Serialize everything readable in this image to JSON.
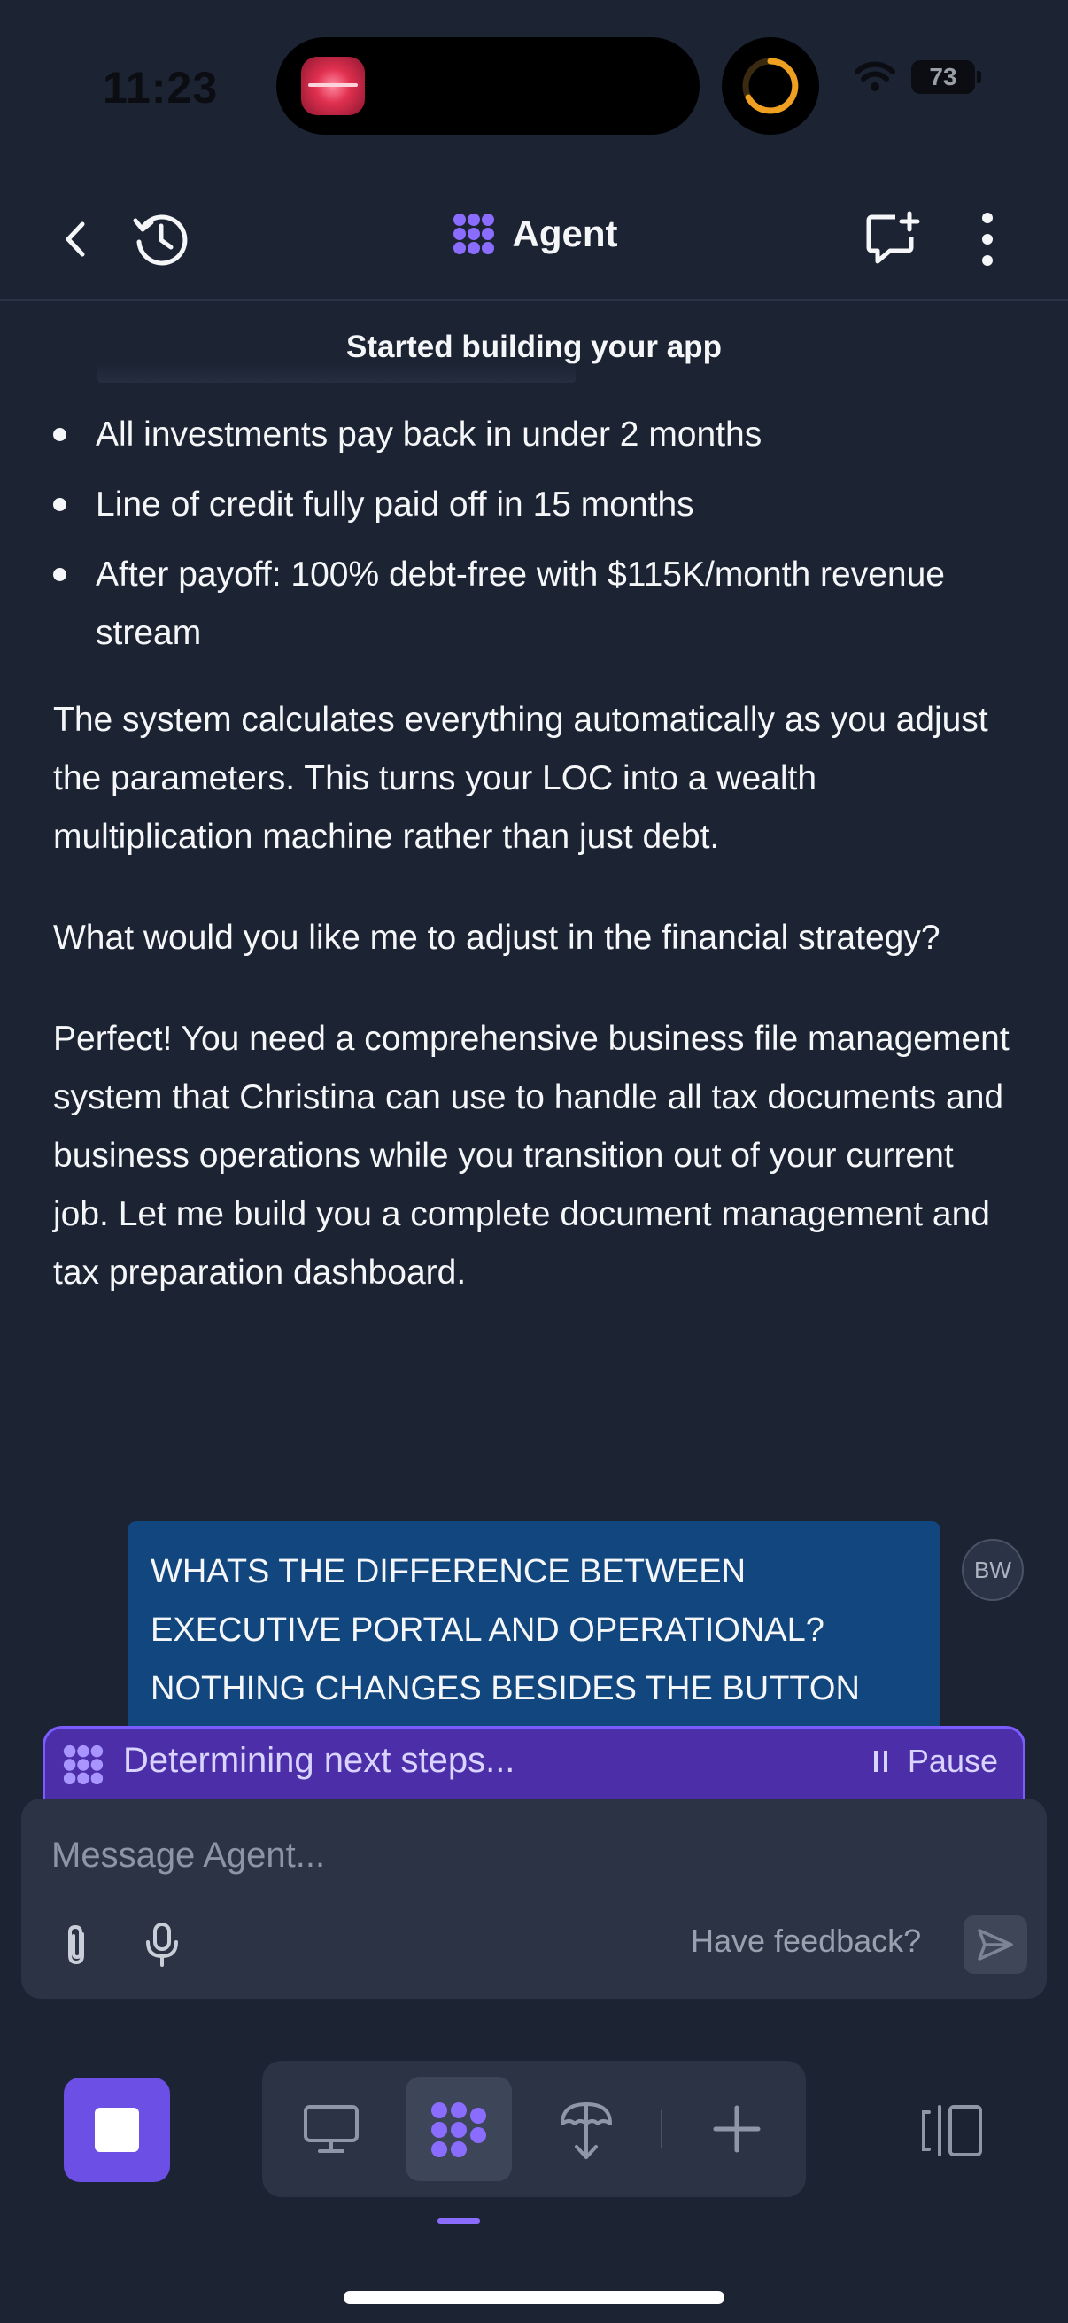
{
  "status_bar": {
    "time": "11:23",
    "battery": "73",
    "icons": [
      "app-activity-icon",
      "timer-ring-icon",
      "wifi-icon",
      "battery-icon"
    ]
  },
  "header": {
    "title": "Agent",
    "icons": [
      "back-icon",
      "history-icon",
      "agent-logo-icon",
      "new-chat-icon",
      "more-icon"
    ]
  },
  "chat": {
    "status_banner": "Started building your app",
    "bullets": [
      "All investments pay back in under 2 months",
      "Line of credit fully paid off in 15 months",
      "After payoff: 100% debt-free with $115K/month revenue stream"
    ],
    "paragraphs": [
      "The system calculates everything automatically as you adjust the parameters. This turns your LOC into a wealth multiplication machine rather than just debt.",
      "What would you like me to adjust in the financial strategy?",
      "Perfect! You need a comprehensive business file management system that Christina can use to handle all tax documents and business operations while you transition out of your current job. Let me build you a complete document management and tax preparation dashboard."
    ],
    "user_message": "WHATS THE DIFFERENCE BETWEEN EXECUTIVE PORTAL AND OPERATIONAL? NOTHING CHANGES BESIDES THE BUTTON",
    "user_avatar": "BW"
  },
  "progress": {
    "text": "Determining next steps...",
    "pause_label": "Pause"
  },
  "composer": {
    "placeholder": "Message Agent...",
    "value": "",
    "feedback_label": "Have feedback?"
  },
  "toolbar": {
    "tools": [
      "stop-icon",
      "desktop-icon",
      "agent-icon",
      "deploy-icon",
      "plus-icon",
      "panes-icon"
    ],
    "active_tool": "agent"
  },
  "colors": {
    "background": "#1c2333",
    "accent": "#6c4fe4",
    "user_bubble": "#12467f",
    "progress_bar": "#4b2ea8"
  }
}
